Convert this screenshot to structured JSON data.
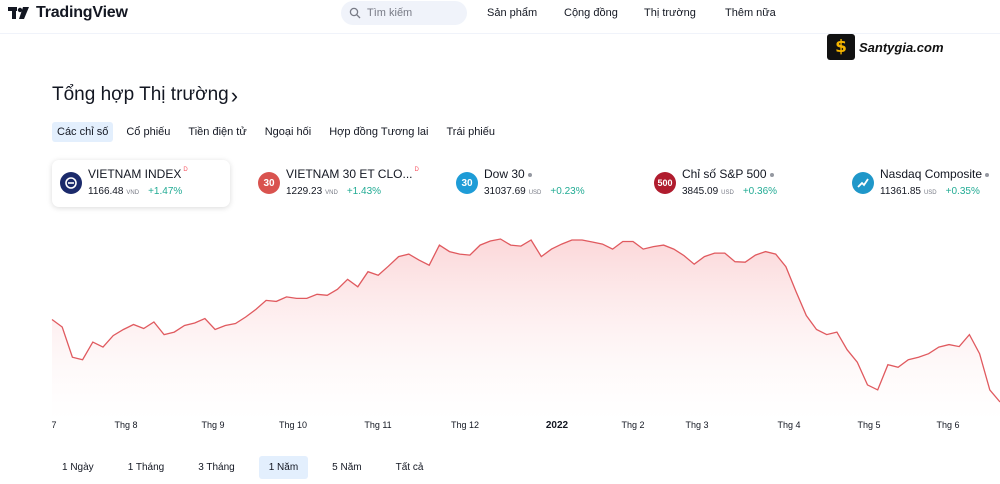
{
  "header": {
    "brand": "TradingView",
    "search_placeholder": "Tìm kiếm",
    "nav": [
      "Sản phẩm",
      "Cộng đồng",
      "Thị trường",
      "Thêm nữa"
    ]
  },
  "watermark": {
    "text": "Santygia.com",
    "mark": "$"
  },
  "title": "Tổng hợp Thị trường",
  "title_chevron": "›",
  "tabs": [
    {
      "label": "Các chỉ số",
      "active": true
    },
    {
      "label": "Cổ phiếu"
    },
    {
      "label": "Tiền điện tử"
    },
    {
      "label": "Ngoại hối"
    },
    {
      "label": "Hợp đồng Tương lai"
    },
    {
      "label": "Trái phiếu"
    }
  ],
  "symbols": [
    {
      "name": "VIETNAM INDEX",
      "sup": "D",
      "price": "1166.48",
      "currency": "VND",
      "change": "+1.47%",
      "icon": "vietnam-index-icon",
      "icon_text": "",
      "icon_color": "#1b2a6b",
      "active": true
    },
    {
      "name": "VIETNAM 30 ET CLO...",
      "sup": "D",
      "price": "1229.23",
      "currency": "VND",
      "change": "+1.43%",
      "icon": "vn30-icon",
      "icon_text": "30",
      "icon_color": "#d9534f"
    },
    {
      "name": "Dow 30",
      "dot": true,
      "price": "31037.69",
      "currency": "USD",
      "change": "+0.23%",
      "icon": "dow30-icon",
      "icon_text": "30",
      "icon_color": "#1e9cd7"
    },
    {
      "name": "Chỉ số S&P 500",
      "dot": true,
      "price": "3845.09",
      "currency": "USD",
      "change": "+0.36%",
      "icon": "sp500-icon",
      "icon_text": "500",
      "icon_color": "#b01c2e"
    },
    {
      "name": "Nasdaq Composite",
      "dot": true,
      "price": "11361.85",
      "currency": "USD",
      "change": "+0.35%",
      "icon": "nasdaq-icon",
      "icon_text": "",
      "icon_color": "#1f97c9"
    }
  ],
  "x_axis_labels": [
    "7",
    "Thg 8",
    "Thg 9",
    "Thg 10",
    "Thg 11",
    "Thg 12",
    "2022",
    "Thg 2",
    "Thg 3",
    "Thg 4",
    "Thg 5",
    "Thg 6"
  ],
  "ranges": [
    {
      "label": "1 Ngày"
    },
    {
      "label": "1 Tháng"
    },
    {
      "label": "3 Tháng"
    },
    {
      "label": "1 Năm",
      "active": true
    },
    {
      "label": "5 Năm"
    },
    {
      "label": "Tất cả"
    }
  ],
  "colors": {
    "line": "#e05a5f",
    "fill_top": "#fde4e5",
    "positive": "#22ab94",
    "accent_bg": "#e3effd"
  },
  "chart_data": {
    "type": "area",
    "series": [
      {
        "values": [
          1330,
          1315,
          1255,
          1250,
          1285,
          1275,
          1298,
          1310,
          1320,
          1312,
          1325,
          1300,
          1305,
          1318,
          1323,
          1332,
          1310,
          1318,
          1322,
          1335,
          1350,
          1368,
          1366,
          1375,
          1372,
          1372,
          1380,
          1378,
          1390,
          1410,
          1395,
          1425,
          1418,
          1436,
          1455,
          1460,
          1448,
          1438,
          1478,
          1465,
          1460,
          1458,
          1478,
          1486,
          1490,
          1478,
          1476,
          1488,
          1455,
          1470,
          1480,
          1488,
          1488,
          1484,
          1480,
          1470,
          1485,
          1485,
          1470,
          1475,
          1478,
          1470,
          1457,
          1440,
          1455,
          1462,
          1462,
          1445,
          1444,
          1458,
          1465,
          1460,
          1435,
          1385,
          1338,
          1310,
          1300,
          1305,
          1270,
          1245,
          1200,
          1190,
          1240,
          1235,
          1250,
          1255,
          1262,
          1275,
          1280,
          1276,
          1300,
          1262,
          1190,
          1166
        ]
      }
    ]
  }
}
